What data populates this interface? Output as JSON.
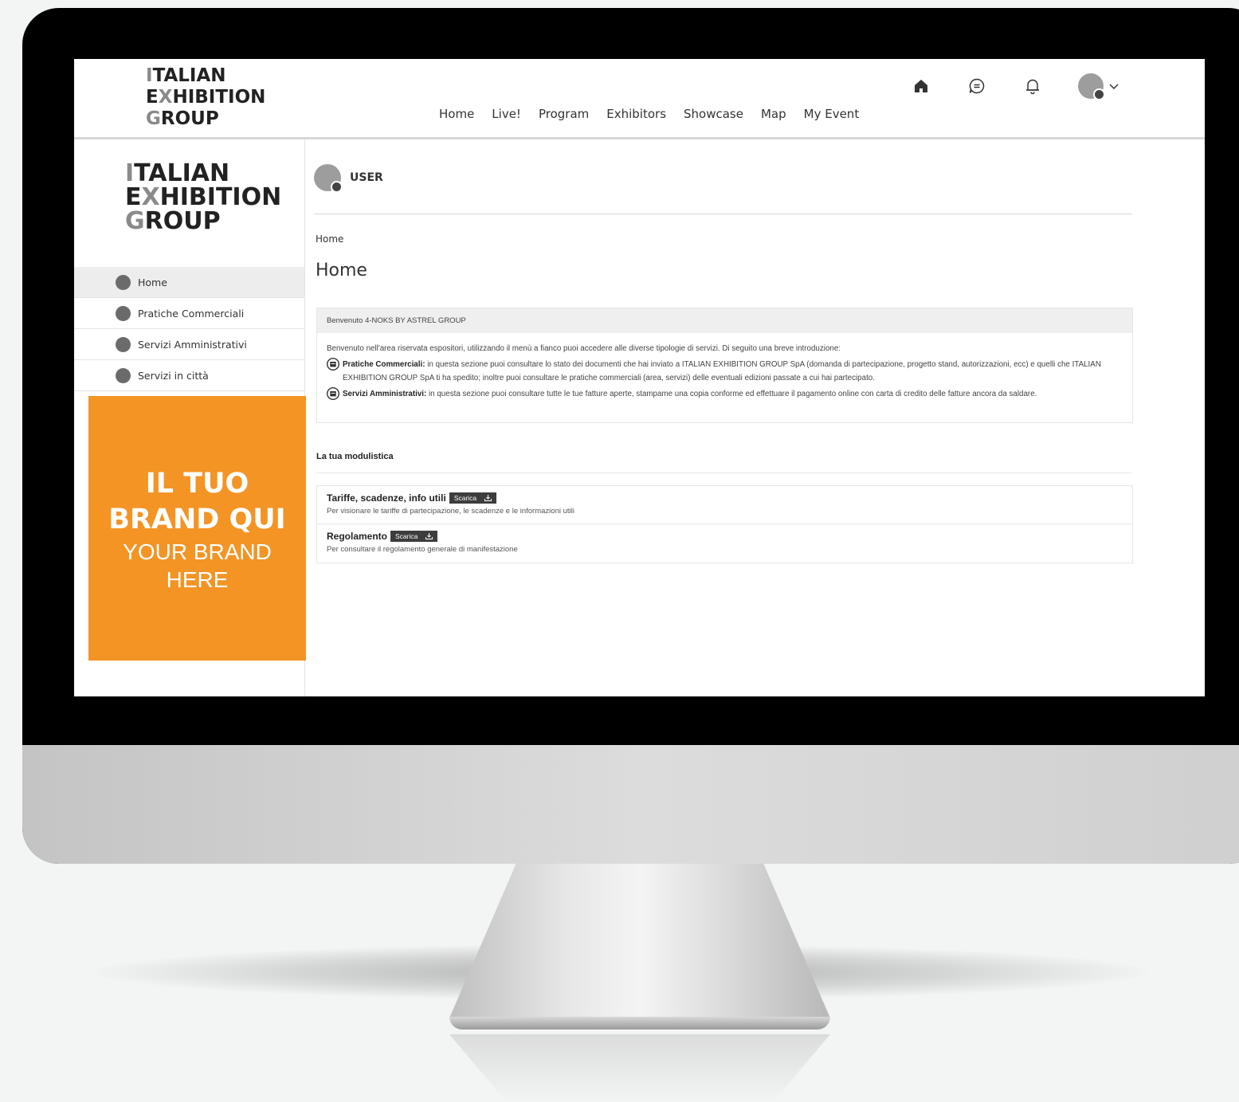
{
  "header": {
    "logo_lines": [
      {
        "first": "I",
        "rest": "TALIAN"
      },
      {
        "first": "E",
        "mid": "X",
        "rest": "HIBITION"
      },
      {
        "first": "G",
        "rest": "ROUP"
      }
    ],
    "nav": [
      "Home",
      "Live!",
      "Program",
      "Exhibitors",
      "Showcase",
      "Map",
      "My Event"
    ],
    "icons": [
      "home-icon",
      "chat-icon",
      "bell-icon",
      "avatar",
      "chevron-down-icon"
    ]
  },
  "sidebar": {
    "menu": [
      {
        "label": "Home",
        "active": true
      },
      {
        "label": "Pratiche Commerciali",
        "active": false
      },
      {
        "label": "Servizi Amministrativi",
        "active": false
      },
      {
        "label": "Servizi in città",
        "active": false
      }
    ],
    "brand": {
      "line1": "IL TUO",
      "line2": "BRAND QUI",
      "line3": "YOUR BRAND",
      "line4": "HERE",
      "color": "#f39425"
    }
  },
  "main": {
    "user": "USER",
    "breadcrumb": "Home",
    "title": "Home",
    "welcome": {
      "header": "Benvenuto 4-NOKS BY ASTREL GROUP",
      "intro": "Benvenuto nell'area riservata espositori, utilizzando il menù a fianco puoi accedere alle diverse tipologie di servizi. Di seguito una breve introduzione:",
      "items": [
        {
          "label": "Pratiche Commerciali:",
          "text": "in questa sezione puoi consultare lo stato dei documenti che hai inviato a ITALIAN EXHIBITION GROUP SpA (domanda di partecipazione, progetto stand, autorizzazioni, ecc) e quelli che ITALIAN EXHIBITION GROUP SpA ti ha spedito; inoltre puoi consultare le pratiche commerciali (area, servizi) delle eventuali edizioni passate a cui hai partecipato."
        },
        {
          "label": "Servizi Amministrativi:",
          "text": "in questa sezione puoi consultare tutte le tue fatture aperte, stampame una copia conforme ed effettuare il pagamento online con carta di credito delle fatture ancora da saldare."
        }
      ]
    },
    "modulistica": {
      "title": "La tua modulistica",
      "docs": [
        {
          "title": "Tariffe, scadenze, info utili",
          "button": "Scarica",
          "desc": "Per visionare le tariffe di partecipazione, le scadenze e le informazioni utili"
        },
        {
          "title": "Regolamento",
          "button": "Scarica",
          "desc": "Per consultare il regolamento generale di manifestazione"
        }
      ]
    }
  }
}
